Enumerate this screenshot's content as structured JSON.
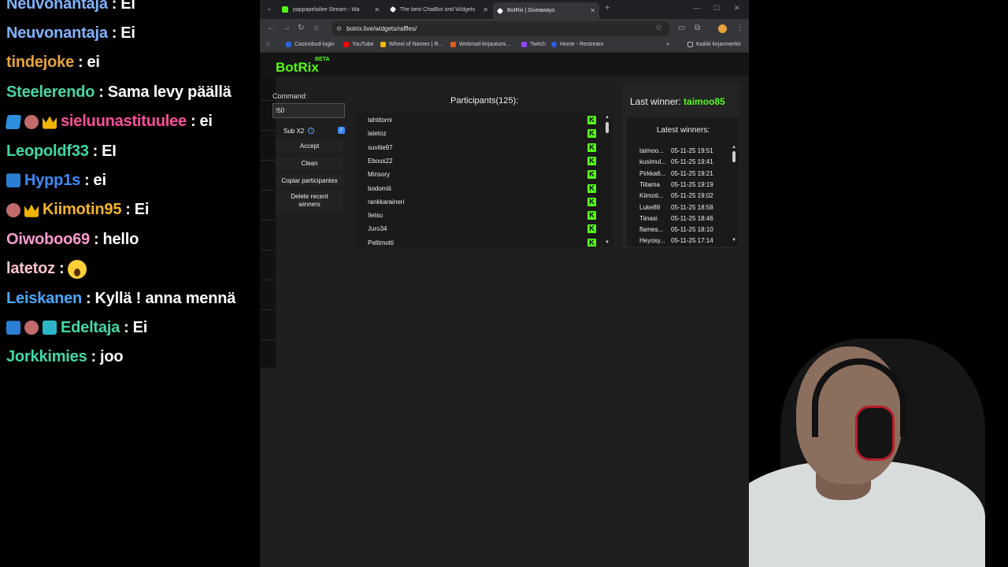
{
  "chat": {
    "messages": [
      {
        "badges": [],
        "user": "Neuvonantaja",
        "color": "#7fb3ff",
        "text": "Ei"
      },
      {
        "badges": [],
        "user": "Neuvonantaja",
        "color": "#7fb3ff",
        "text": "Ei"
      },
      {
        "badges": [],
        "user": "tindejoke",
        "color": "#e8a33a",
        "text": "ei"
      },
      {
        "badges": [],
        "user": "Steelerendo",
        "color": "#48d6a6",
        "text": "Sama levy päällä"
      },
      {
        "badges": [
          "cube-icon",
          "bear-icon",
          "crown-icon"
        ],
        "user": "sieluunastituulee",
        "color": "#ff4f9a",
        "text": "ei"
      },
      {
        "badges": [],
        "user": "Leopoldf33",
        "color": "#3fd9a8",
        "text": "EI"
      },
      {
        "badges": [
          "prime-icon"
        ],
        "user": "Hypp1s",
        "color": "#3d8bff",
        "text": "ei"
      },
      {
        "badges": [
          "bear-icon",
          "crown-icon"
        ],
        "user": "Kiimotin95",
        "color": "#f5b42a",
        "text": "Ei"
      },
      {
        "badges": [],
        "user": "Oiwoboo69",
        "color": "#ff9ad1",
        "text": "hello"
      },
      {
        "badges": [],
        "user": "latetoz",
        "color": "#ffc4d0",
        "text": "",
        "emote": "scream-emoji"
      },
      {
        "badges": [],
        "user": "Leiskanen",
        "color": "#4aa8ff",
        "text": "Kyllä ! anna mennä"
      },
      {
        "badges": [
          "prime-icon",
          "bear-icon",
          "grid-icon"
        ],
        "user": "Edeltaja",
        "color": "#3fd9a8",
        "text": "Ei"
      },
      {
        "badges": [],
        "user": "Jorkkimies",
        "color": "#3fd9a8",
        "text": "joo"
      }
    ]
  },
  "browser": {
    "tabs": [
      {
        "label": "pappapelailee Stream - Wa",
        "active": false,
        "favicon": "kick-icon"
      },
      {
        "label": "The best ChatBot and Widgets",
        "active": false,
        "favicon": "botrix-icon"
      },
      {
        "label": "BotRix | Giveaways",
        "active": true,
        "favicon": "botrix-icon"
      }
    ],
    "new_tab": "+",
    "url": "botrix.live/widgets/raffles/",
    "bookmarks": [
      {
        "label": "Casinobud-login",
        "color": "#2a62d6"
      },
      {
        "label": "YouTube",
        "color": "#ff0000"
      },
      {
        "label": "Wheel of Names | R...",
        "color": "#f5b400"
      },
      {
        "label": "Webmail-kirjautumi...",
        "color": "#e35d1c"
      },
      {
        "label": "Twitch",
        "color": "#9146ff"
      },
      {
        "label": "Home - Restream",
        "color": "#2f5bea"
      }
    ],
    "bookmarks_more": "»",
    "all_bookmarks": "Kaikki kirjanmerkit"
  },
  "page": {
    "logo": "BotRix",
    "logo_badge": "BETA",
    "command_label": "Command:",
    "command_value": "!50",
    "sub_label": "Sub X2",
    "sub_checked": true,
    "buttons": {
      "accept": "Accept",
      "clean": "Clean",
      "copy": "Copiar participantes",
      "delete_line1": "Delete recent",
      "delete_line2": "winners"
    },
    "participants_title": "Participants(125):",
    "participants": [
      "tahtitorni",
      "latetoz",
      "suvitie97",
      "Ebous22",
      "Minsory",
      "bodomiii",
      "rankkaraineri",
      "Iletsu",
      "Juro34",
      "Peltimotti"
    ],
    "last_winner_label": "Last winner:",
    "last_winner": "taimoo85",
    "latest_winners_title": "Latest winners:",
    "latest_winners": [
      {
        "name": "taimoo...",
        "date": "05-11-25 19:51"
      },
      {
        "name": "kusimul...",
        "date": "05-11-25 19:41"
      },
      {
        "name": "Pirkka6...",
        "date": "05-11-25 19:21"
      },
      {
        "name": "Tiitama",
        "date": "05-11-25 19:19"
      },
      {
        "name": "Kiimoti...",
        "date": "05-11-25 19:02"
      },
      {
        "name": "Luke89",
        "date": "05-11-25 18:58"
      },
      {
        "name": "Tiinasi",
        "date": "05-11-25 18:46"
      },
      {
        "name": "flames...",
        "date": "05-11-25 18:10"
      },
      {
        "name": "Heyosy...",
        "date": "05-11-25 17:14"
      }
    ],
    "accent_color": "#53fc18"
  }
}
